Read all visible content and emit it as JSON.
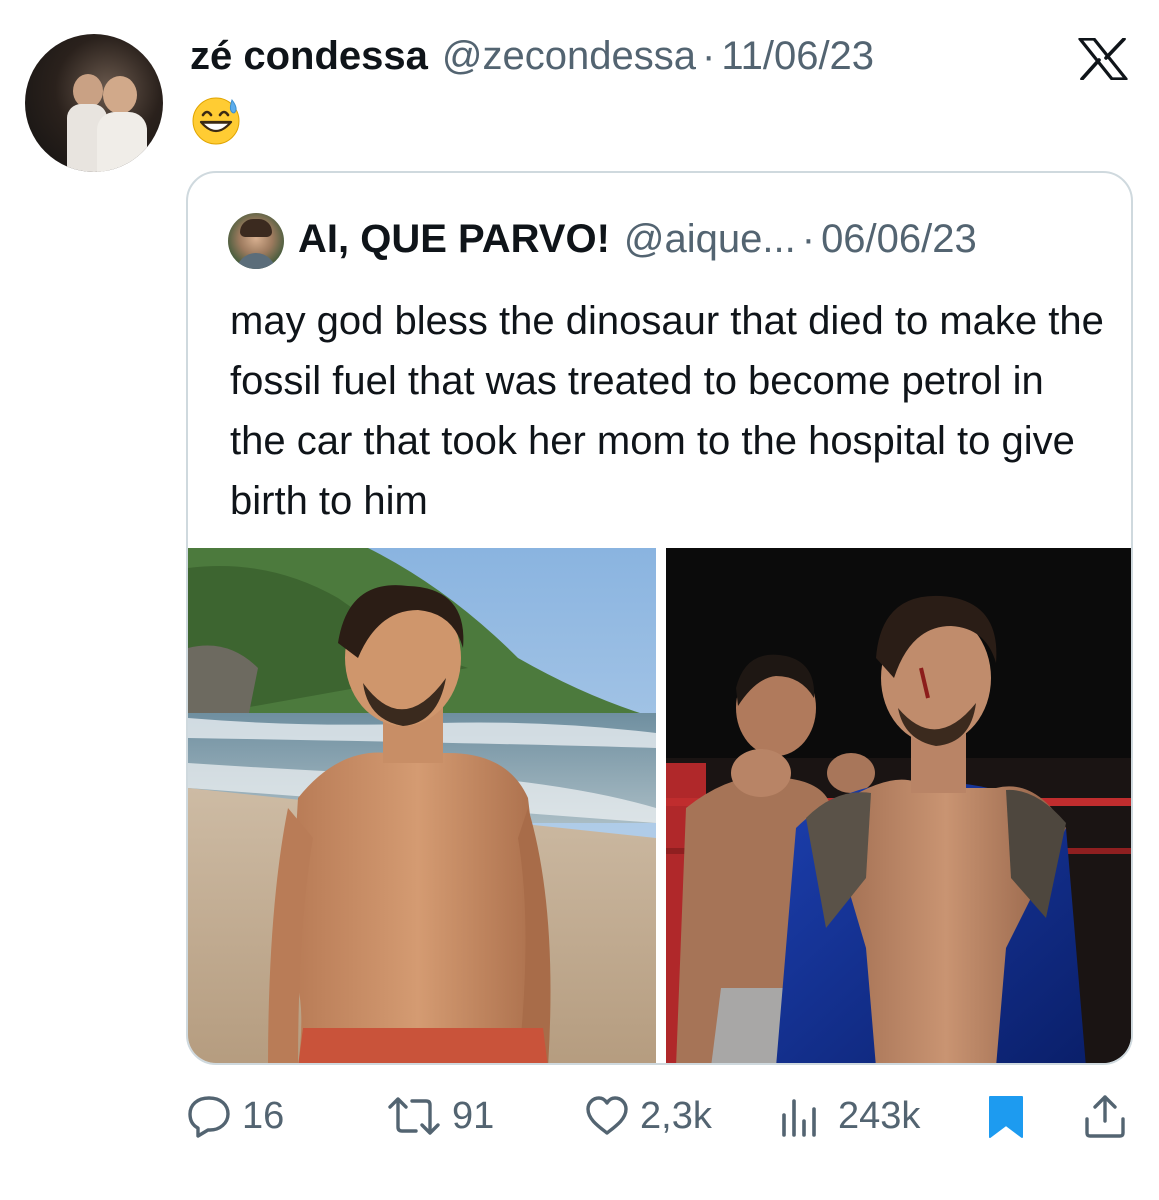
{
  "tweet": {
    "display_name": "zé condessa",
    "handle": "@zecondessa",
    "separator": "·",
    "date": "11/06/23",
    "emoji": "😅"
  },
  "quoted": {
    "display_name": "AI, QUE PARVO!",
    "handle": "@aique...",
    "separator": "·",
    "date": "06/06/23",
    "text": "may god bless the dinosaur that died to make the fossil fuel that was treated to become petrol in the car that took her mom to the hospital to give birth to him"
  },
  "actions": {
    "replies": "16",
    "retweets": "91",
    "likes": "2,3k",
    "views": "243k"
  },
  "colors": {
    "text_primary": "#0f1419",
    "text_secondary": "#536471",
    "border": "#cfd9de",
    "bookmark_active": "#1d9bf0"
  },
  "icons": [
    "x-logo-icon",
    "reply-icon",
    "retweet-icon",
    "like-icon",
    "views-icon",
    "bookmark-icon",
    "share-icon"
  ]
}
